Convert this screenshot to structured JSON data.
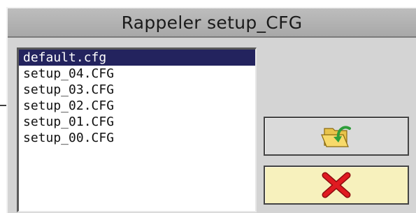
{
  "dialog": {
    "title": "Rappeler setup_CFG"
  },
  "file_list": {
    "items": [
      {
        "label": "default.cfg",
        "selected": true
      },
      {
        "label": "setup_04.CFG",
        "selected": false
      },
      {
        "label": "setup_03.CFG",
        "selected": false
      },
      {
        "label": "setup_02.CFG",
        "selected": false
      },
      {
        "label": "setup_01.CFG",
        "selected": false
      },
      {
        "label": "setup_00.CFG",
        "selected": false
      }
    ]
  },
  "buttons": {
    "load": {
      "icon": "folder-open-icon"
    },
    "cancel": {
      "icon": "red-x-icon"
    }
  },
  "colors": {
    "selection": "#23235e",
    "cancel_button_bg": "#f7f1bd",
    "load_arrow": "#2e9e3a",
    "cancel_x": "#d9181e"
  }
}
